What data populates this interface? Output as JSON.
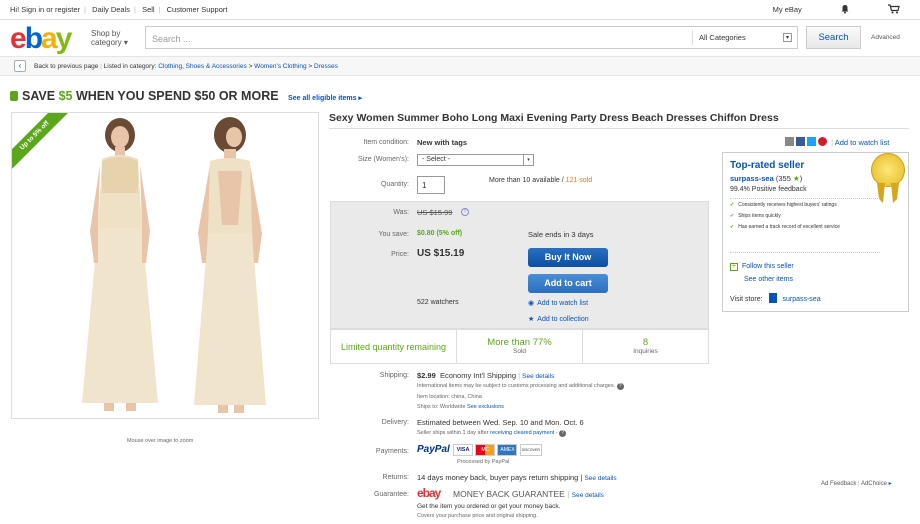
{
  "topbar": {
    "greeting": "Hi! Sign in or register",
    "links": [
      "Daily Deals",
      "Sell",
      "Customer Support"
    ],
    "my_ebay": "My eBay"
  },
  "header": {
    "logo": {
      "e": "e",
      "b": "b",
      "a": "a",
      "y": "y"
    },
    "shop_by_1": "Shop by",
    "shop_by_2": "category",
    "search_placeholder": "Search ...",
    "category_select": "All Categories",
    "search_button": "Search",
    "advanced": "Advanced"
  },
  "breadcrumb": {
    "back": "Back to previous page",
    "listed_in": "Listed in category:",
    "path": [
      "Clothing, Shoes & Accessories",
      "Women's Clothing",
      "Dresses"
    ]
  },
  "promo": {
    "prefix": "SAVE ",
    "amount": "$5",
    "suffix": " WHEN YOU SPEND $50 OR MORE",
    "see_all": "See all eligible items ▸"
  },
  "image": {
    "ribbon": "Up to 5% off",
    "zoom_hint": "Mouse over image to zoom"
  },
  "item": {
    "title": "Sexy Women Summer Boho Long Maxi Evening Party Dress Beach Dresses Chiffon Dress",
    "condition_label": "Item condition:",
    "condition": "New with tags",
    "size_label": "Size (Women's):",
    "size_select": "- Select -",
    "quantity_label": "Quantity:",
    "quantity": "1",
    "available": "More than 10 available / ",
    "sold": "121 sold",
    "add_watch_top": "Add to watch list"
  },
  "pricing": {
    "was_label": "Was:",
    "was": "US $15.99",
    "save_label": "You save:",
    "save": "$0.80 (5% off)",
    "sale_ends": "Sale ends in 3 days",
    "price_label": "Price:",
    "price": "US $15.19",
    "buy_now": "Buy It Now",
    "add_cart": "Add to cart",
    "watchers": "522 watchers",
    "add_watch": "Add to watch list",
    "add_collection": "Add to collection"
  },
  "strip": {
    "limited": "Limited quantity remaining",
    "sold_big": "More than 77%",
    "sold_small": "Sold",
    "inq_big": "8",
    "inq_small": "Inquiries"
  },
  "shipping": {
    "label": "Shipping:",
    "cost": "$2.99",
    "method": "Economy Int'l Shipping",
    "see_details": "See details",
    "intl_note": "International items may be subject to customs processing and additional charges.",
    "location": "Item location:  china, China",
    "ships_to": "Ships to:  Worldwide",
    "see_exclusions": "See exclusions"
  },
  "delivery": {
    "label": "Delivery:",
    "estimate": "Estimated between Wed. Sep. 10 and Mon. Oct. 6",
    "note_prefix": "Seller ships within 1 day after ",
    "note_link": "receiving cleared payment",
    "note_suffix": " -"
  },
  "payments": {
    "label": "Payments:",
    "paypal": "PayPal",
    "cards": [
      "VISA",
      "MC",
      "AMEX",
      "DISCOVER"
    ],
    "processed": "Processed by PayPal"
  },
  "returns": {
    "label": "Returns:",
    "text": "14 days money back, buyer pays return shipping |",
    "see_details": "See details"
  },
  "guarantee": {
    "label": "Guarantee:",
    "brand": "ebay",
    "text": "MONEY BACK GUARANTEE",
    "see_details": "See details",
    "line1": "Get the item you ordered or get your money back.",
    "line2": "Covers your purchase price and original shipping."
  },
  "seller": {
    "heading": "Top-rated seller",
    "name": "surpass-sea",
    "feedback_count": "(355",
    "star": "★",
    "feedback_close": ")",
    "positive": "99.4% Positive feedback",
    "bullets": [
      "Consistently receives highest buyers' ratings",
      "Ships items quickly",
      "Has earned a track record of excellent service"
    ],
    "follow": "Follow this seller",
    "see_other": "See other items",
    "visit_store_label": "Visit store:",
    "store": "surpass-sea"
  },
  "footer": {
    "ad_feedback": "Ad Feedback",
    "adchoice": "AdChoice"
  },
  "colors": {
    "accent": "#0654ba",
    "green": "#5ba71b",
    "sold": "#e47911",
    "buy": "#0b4fa3"
  }
}
